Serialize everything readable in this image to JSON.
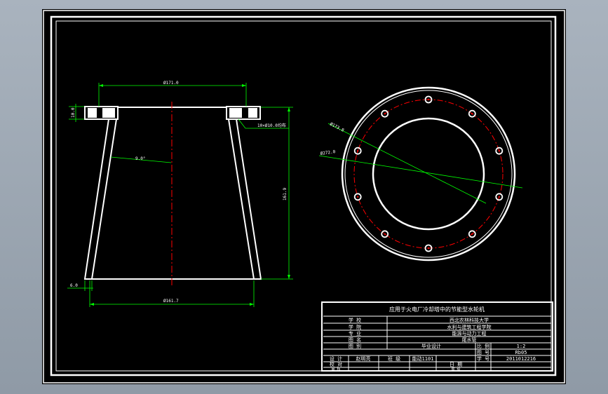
{
  "colors": {
    "background": "#000000",
    "frame": "#ffffff",
    "dimension": "#00ff00",
    "centerline": "#ff0000",
    "outer_bg": "#9aa5b1"
  },
  "drawing": {
    "left_view": {
      "dim_top_width": "Ø171.0",
      "dim_flange_thickness": "10.0",
      "dim_holes": "10×Ø10.0均布",
      "dim_angle": "9.0°",
      "dim_height": "161.9",
      "dim_bottom_width": "Ø161.7",
      "dim_bottom_wall": "6.0"
    },
    "right_view": {
      "dim_bolt_circle": "Ø173.8",
      "dim_outer": "Ø272.0"
    }
  },
  "title_block": {
    "title": "应用于火电厂冷却塔中的节能型水轮机",
    "rows": [
      {
        "label": "学 校",
        "value": "西北农林科技大学"
      },
      {
        "label": "学 院",
        "value": "水利与建筑工程学院"
      },
      {
        "label": "专 业",
        "value": "能源与动力工程"
      },
      {
        "label": "图 名",
        "value": "尾水管"
      }
    ],
    "footer": {
      "row1": {
        "label": "图 别",
        "value": "毕业设计",
        "k1": "比 例",
        "v1": "1:2"
      },
      "row2": {
        "k1": "图 号",
        "v1": "Rb05"
      },
      "row3": {
        "c1": "设 计",
        "c2": "赵明亮",
        "c3": "班 级",
        "c4": "能动1101",
        "c5": "学 号",
        "c6": "2011012216"
      },
      "row4": {
        "c1": "校 对",
        "c5": "日 期"
      },
      "row5": {
        "c1": "审 核",
        "c5": "成 绩"
      }
    }
  }
}
